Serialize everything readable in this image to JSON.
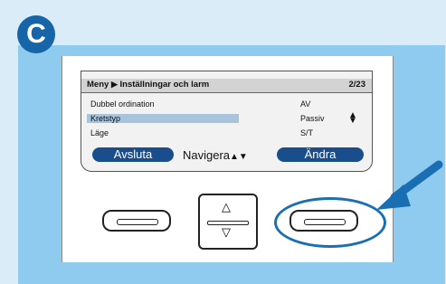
{
  "badge": {
    "letter": "C"
  },
  "screen": {
    "breadcrumb_root": "Meny",
    "breadcrumb_page": "Inställningar och larm",
    "page_indicator": "2/23",
    "rows": [
      {
        "label": "Dubbel ordination",
        "value": "AV"
      },
      {
        "label": "Kretstyp",
        "value": "Passiv"
      },
      {
        "label": "Läge",
        "value": "S/T"
      }
    ],
    "softkeys": {
      "left": "Avsluta",
      "center": "Navigera",
      "right": "Ändra"
    }
  },
  "icons": {
    "up": "▲",
    "down": "▼",
    "up_outline": "△",
    "down_outline": "▽",
    "breadcrumb_sep": "▶"
  },
  "colors": {
    "accent": "#1565a8",
    "softkey": "#1a4d8c",
    "highlight": "#a8c4dc"
  }
}
